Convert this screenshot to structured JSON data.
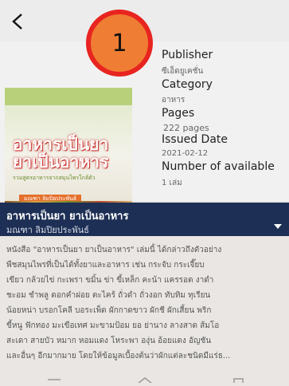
{
  "badge": {
    "number": "1"
  },
  "book": {
    "cover": {
      "title_line1": "อาหารเป็นยา",
      "title_line2": "ยาเป็นอาหาร",
      "subtitle": "รวมสูตรอาหารจากสมุนไพรใกล้ตัว",
      "author": "มณฑา ลิมปิยประพันธ์"
    },
    "meta": {
      "publisher_label": "Publisher",
      "publisher_value": "ซีเอ็ดยูเคชั่น",
      "category_label": "Category",
      "category_value": "อาหาร",
      "pages_label": "Pages",
      "pages_value": "222 pages",
      "issued_label": "Issued Date",
      "issued_value": "2021-02-12",
      "available_label": "Number of available",
      "available_value": "1 เล่ม"
    },
    "title": "อาหารเป็นยา ยาเป็นอาหาร",
    "author": "มณฑา ลิมปิยประพันธ์",
    "description_lines": [
      "หนังสือ \"อาหารเป็นยา ยาเป็นอาหาร\" เล่มนี้ ได้กล่าวถึงตัวอย่าง",
      "พืชสมุนไพรที่เป็นได้ทั้งยาและอาหาร เช่น กระจับ กระเจี๊ยบ",
      "เขียว กล้วยไข่ กะเพรา ขมิ้น ข่า ขี้เหล็ก คะน้า แครรอต งาดำ",
      "ชะอม ชำพลู ดอกคำฝอย ตะไคร้ ถั่วดำ ถั่วงอก ทับทิม ทุเรียน",
      "น้อยหน่า บรอกโคลี บอระเพ็ด ผักกาดขาว ผักชี ผักเสี้ยน พริก",
      "ขี้หนู ฟักทอง มะเขือเทศ มะขามป้อม ยอ ย่านาง ลางสาด ส้มโอ",
      "สะเดา สายบัว หมาก หอมแดง โหระพา องุ่น อ้อยแดง อัญชัน",
      "และอื่นๆ อีกมากมาย โดยให้ข้อมูลเบื้องต้นว่าผักแต่ละชนิดมีแร่ธ..."
    ]
  }
}
